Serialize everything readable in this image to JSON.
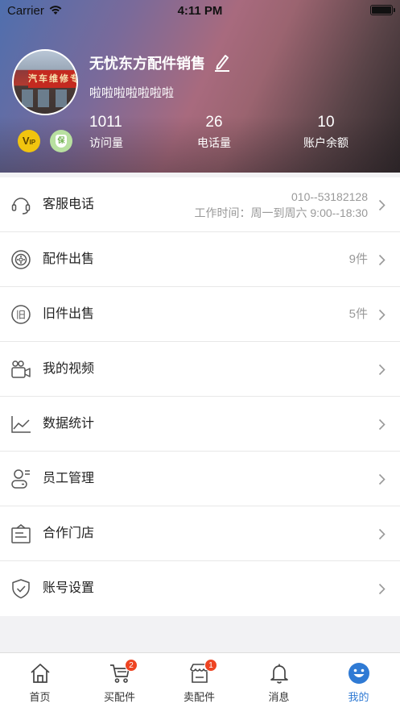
{
  "status_bar": {
    "carrier": "Carrier",
    "time": "4:11 PM"
  },
  "profile": {
    "shop_name": "无忧东方配件销售",
    "description": "啦啦啦啦啦啦啦",
    "avatar_sign_text": "汽车维修专",
    "vip_badge": "V",
    "vip_badge_sub": "IP",
    "bao_badge": "保",
    "stats": [
      {
        "value": "1011",
        "label": "访问量"
      },
      {
        "value": "26",
        "label": "电话量"
      },
      {
        "value": "10",
        "label": "账户余额"
      }
    ]
  },
  "menu": {
    "service_phone": {
      "title": "客服电话",
      "phone": "010--53182128",
      "hours": "工作时间：周一到周六 9:00--18:30",
      "icon": "headset-icon"
    },
    "parts_sale": {
      "title": "配件出售",
      "value": "9件",
      "icon": "parts-icon"
    },
    "used_sale": {
      "title": "旧件出售",
      "value": "5件",
      "icon": "used-icon"
    },
    "videos": {
      "title": "我的视频",
      "icon": "video-icon"
    },
    "stats": {
      "title": "数据统计",
      "icon": "chart-icon"
    },
    "staff": {
      "title": "员工管理",
      "icon": "staff-icon"
    },
    "partner_store": {
      "title": "合作门店",
      "icon": "store-icon"
    },
    "account": {
      "title": "账号设置",
      "icon": "shield-check-icon"
    }
  },
  "tabbar": {
    "home": {
      "label": "首页",
      "icon": "home-icon"
    },
    "buy": {
      "label": "买配件",
      "icon": "cart-icon",
      "badge": "2"
    },
    "sell": {
      "label": "卖配件",
      "icon": "shop-icon",
      "badge": "1"
    },
    "messages": {
      "label": "消息",
      "icon": "bell-icon"
    },
    "mine": {
      "label": "我的",
      "icon": "smile-icon"
    }
  },
  "colors": {
    "accent": "#2f7ad4",
    "badge": "#ee4422",
    "vip": "#f1c40f"
  }
}
